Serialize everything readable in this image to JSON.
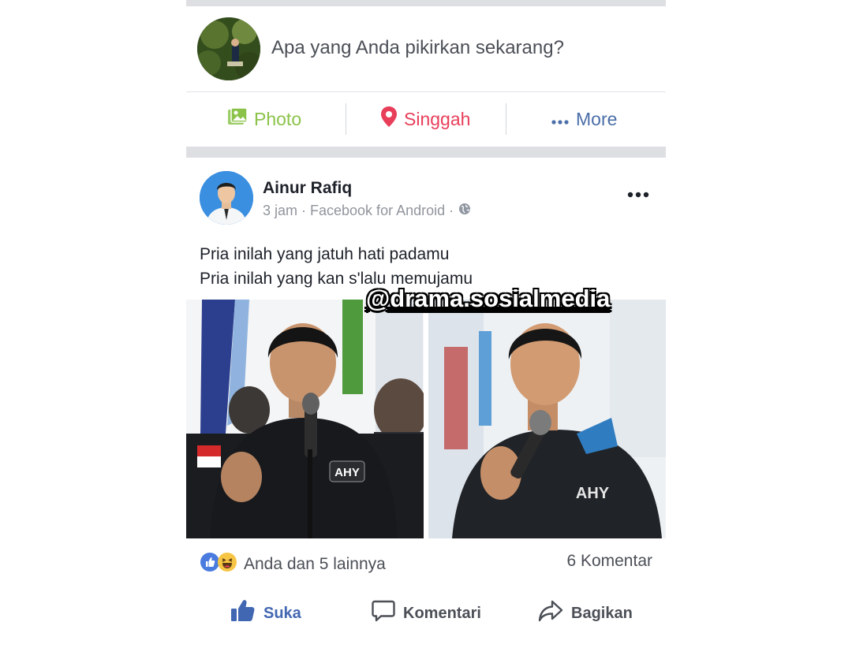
{
  "composer": {
    "prompt": "Apa yang Anda pikirkan sekarang?",
    "actions": [
      {
        "label": "Photo",
        "icon": "photo-icon",
        "color": "#8bc34a"
      },
      {
        "label": "Singgah",
        "icon": "location-pin-icon",
        "color": "#e83e5a"
      },
      {
        "label": "More",
        "icon": "more-dots-icon",
        "color": "#4b6ea9"
      }
    ]
  },
  "post": {
    "author": "Ainur Rafiq",
    "meta": "3 jam · Facebook for Android ·",
    "privacy_icon": "globe-icon",
    "text_lines": [
      "Pria inilah yang jatuh hati padamu",
      "Pria inilah yang kan s'lalu memujamu"
    ],
    "watermark": "@drama.sosialmedia",
    "photos": [
      {
        "shirt_label": "AHY"
      },
      {
        "shirt_label": "AHY"
      }
    ],
    "reactions_text": "Anda dan 5 lainnya",
    "comments_text": "6 Komentar",
    "actions": [
      {
        "label": "Suka",
        "icon": "like-icon",
        "color": "#4267b2"
      },
      {
        "label": "Komentari",
        "icon": "comment-icon",
        "color": "#4b4f56"
      },
      {
        "label": "Bagikan",
        "icon": "share-icon",
        "color": "#4b4f56"
      }
    ]
  }
}
